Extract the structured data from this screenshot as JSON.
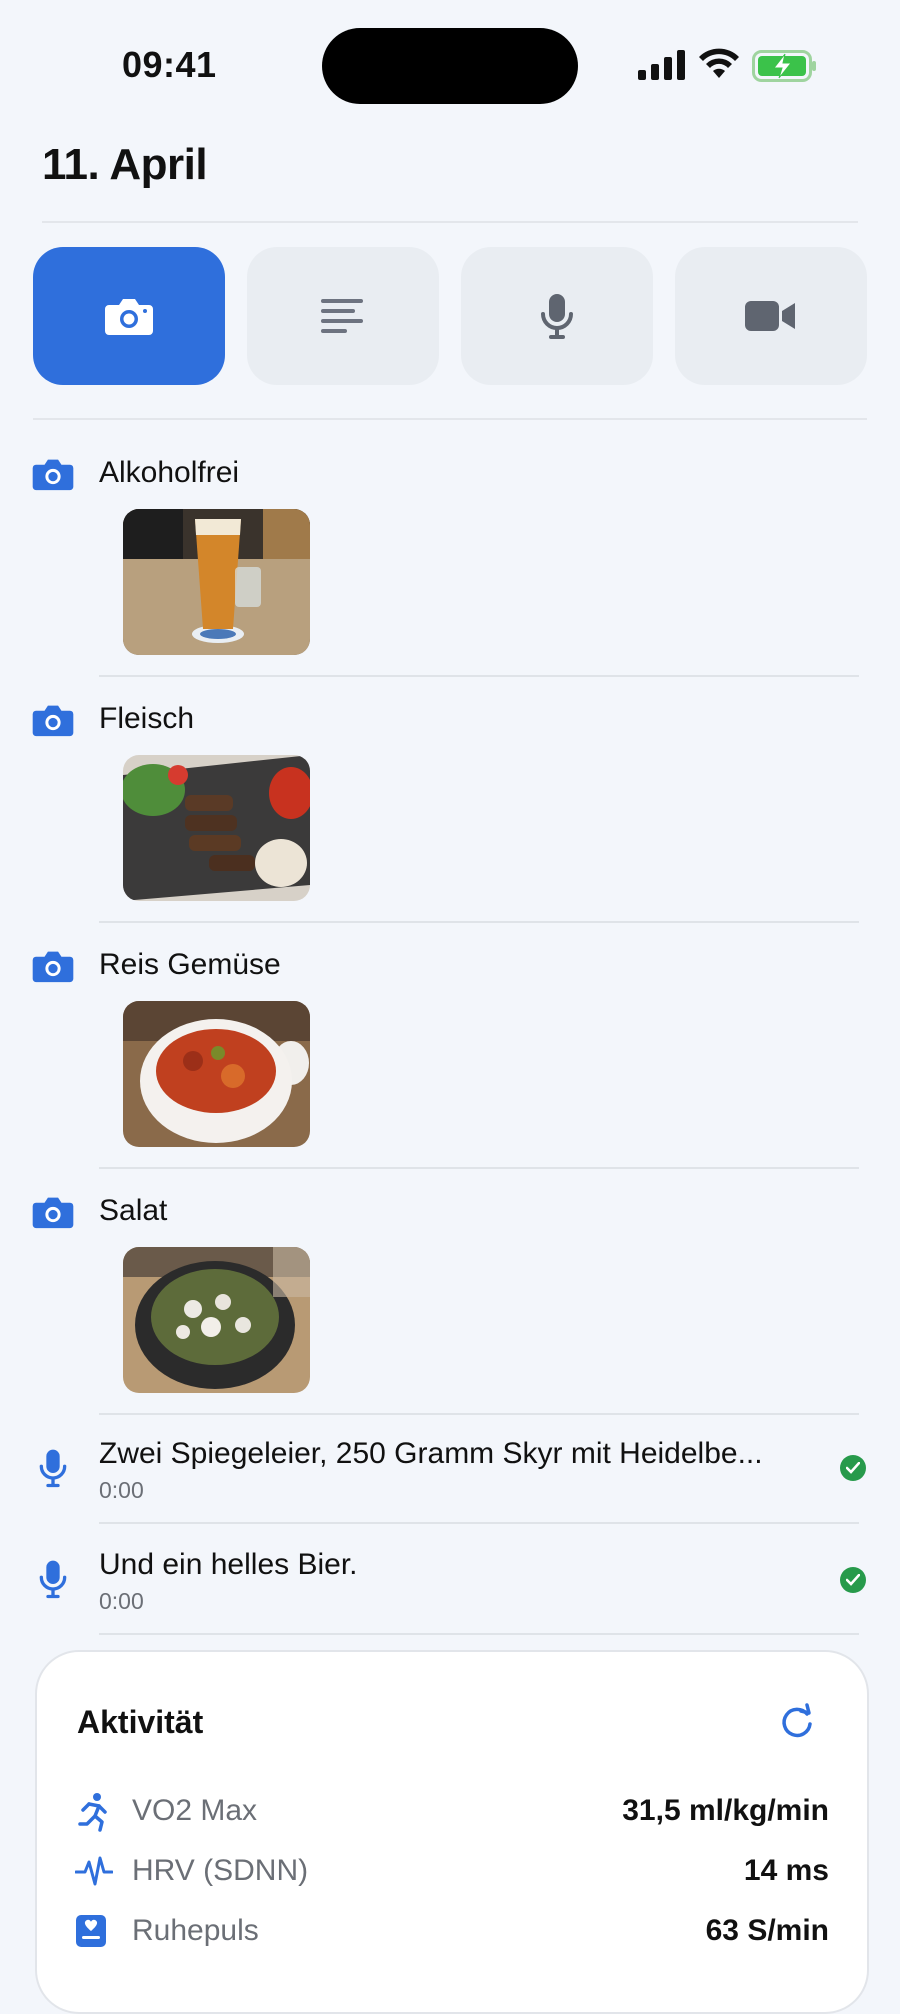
{
  "status": {
    "time": "09:41"
  },
  "page": {
    "title": "11. April"
  },
  "tabs": [
    {
      "name": "photo",
      "icon": "camera-icon",
      "active": true
    },
    {
      "name": "text",
      "icon": "text-lines-icon",
      "active": false
    },
    {
      "name": "voice",
      "icon": "microphone-icon",
      "active": false
    },
    {
      "name": "video",
      "icon": "video-camera-icon",
      "active": false
    }
  ],
  "photo_entries": [
    {
      "label": "Alkoholfrei",
      "photo": "beer glass on table"
    },
    {
      "label": "Fleisch",
      "photo": "grilled meat on slate plate"
    },
    {
      "label": "Reis Gemüse",
      "photo": "bowl of rice and vegetables"
    },
    {
      "label": "Salat",
      "photo": "salad bowl with feta"
    }
  ],
  "voice_entries": [
    {
      "text": "Zwei Spiegeleier, 250 Gramm Skyr mit Heidelbe...",
      "duration": "0:00",
      "status": "done"
    },
    {
      "text": "Und ein helles Bier.",
      "duration": "0:00",
      "status": "done"
    }
  ],
  "activity": {
    "title": "Aktivität",
    "metrics": [
      {
        "icon": "running-figure-icon",
        "label": "VO2 Max",
        "value": "31,5 ml/kg/min"
      },
      {
        "icon": "heartbeat-icon",
        "label": "HRV (SDNN)",
        "value": "14 ms"
      },
      {
        "icon": "heart-card-icon",
        "label": "Ruhepuls",
        "value": "63 S/min"
      }
    ]
  },
  "colors": {
    "accent": "#2f6fdc",
    "success": "#279a4b",
    "background": "#f3f6fb"
  }
}
